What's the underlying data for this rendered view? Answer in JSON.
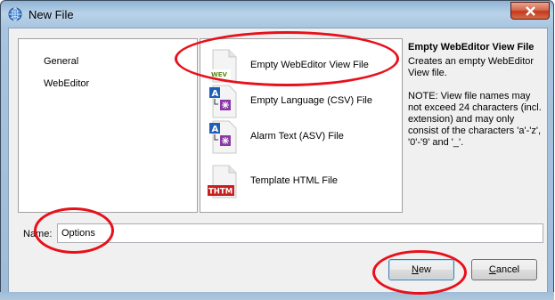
{
  "window": {
    "title": "New File",
    "close_icon": "close-icon"
  },
  "categories": [
    {
      "label": "General"
    },
    {
      "label": "WebEditor"
    }
  ],
  "templates": [
    {
      "label": "Empty WebEditor View File",
      "icon": "wev-file-icon",
      "icon_text": "WEV"
    },
    {
      "label": "Empty Language (CSV) File",
      "icon": "language-file-icon"
    },
    {
      "label": "Alarm Text (ASV) File",
      "icon": "alarm-text-file-icon"
    },
    {
      "label": "Template HTML File",
      "icon": "html-template-icon",
      "icon_text": "THTM"
    }
  ],
  "description": {
    "title": "Empty WebEditor View File",
    "text": "Creates an empty WebEditor View file.\n\nNOTE: View file names may not exceed 24 characters (incl. extension) and may only consist of the characters 'a'-'z', '0'-'9' and '_'."
  },
  "name_field": {
    "label": "Name:",
    "value": "Options"
  },
  "buttons": {
    "new": "New",
    "cancel": "Cancel"
  },
  "colors": {
    "annotation_red": "#e8101a",
    "title_gradient": "#a8c4df",
    "close_red": "#c4391c"
  }
}
